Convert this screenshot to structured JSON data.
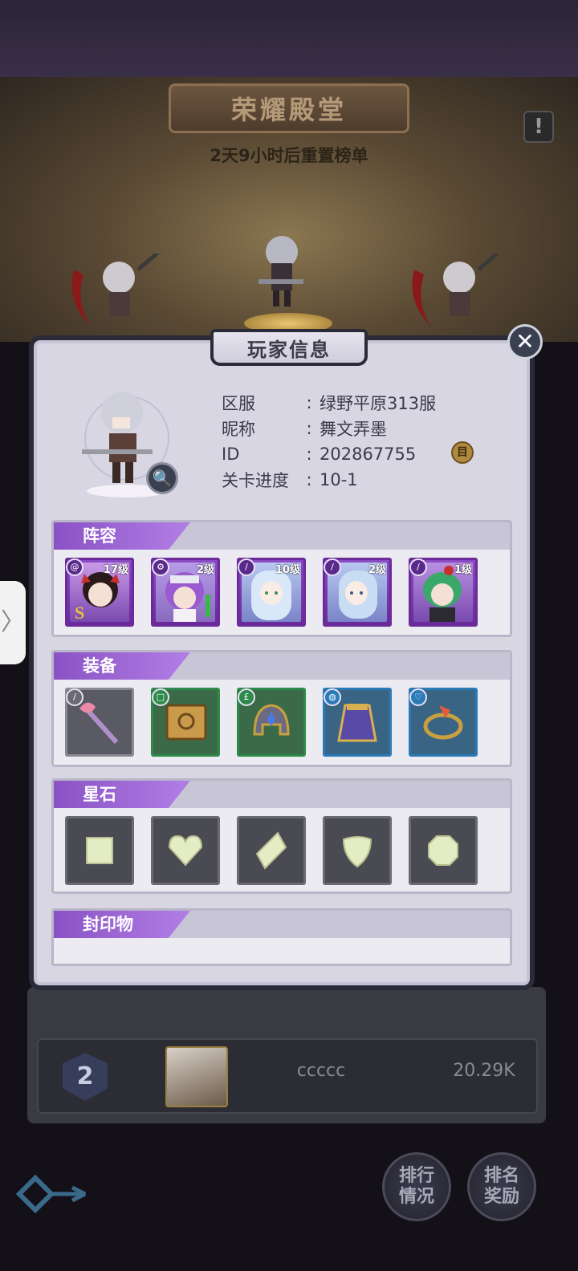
{
  "hall": {
    "title": "荣耀殿堂",
    "reset_text": "2天9小时后重置榜单",
    "alert_icon": "!"
  },
  "side_handle": {
    "icon": "〉"
  },
  "modal": {
    "title": "玩家信息",
    "close_icon": "✕",
    "magnify_icon": "🔍",
    "copy_icon": "目",
    "info": [
      {
        "label": "区服",
        "value": "绿野平原313服"
      },
      {
        "label": "昵称",
        "value": "舞文弄墨"
      },
      {
        "label": "ID",
        "value": "202867755"
      },
      {
        "label": "关卡进度",
        "value": "10-1"
      }
    ],
    "colon": ":",
    "lineup": {
      "title": "阵容",
      "heroes": [
        {
          "level": "17级",
          "icon": "swirl-icon"
        },
        {
          "level": "2级",
          "icon": "gear-icon"
        },
        {
          "level": "10级",
          "icon": "sword-icon"
        },
        {
          "level": "2级",
          "icon": "sword-icon"
        },
        {
          "level": "1级",
          "icon": "sword-icon"
        }
      ]
    },
    "equipment": {
      "title": "装备",
      "items": [
        {
          "name": "staff",
          "rarity": "grey"
        },
        {
          "name": "book",
          "rarity": "green"
        },
        {
          "name": "helmet",
          "rarity": "green"
        },
        {
          "name": "cape",
          "rarity": "blue"
        },
        {
          "name": "ring",
          "rarity": "blue"
        }
      ]
    },
    "starstones": {
      "title": "星石",
      "items": [
        "square",
        "heart",
        "diamond",
        "trillion",
        "round"
      ]
    },
    "seals": {
      "title": "封印物"
    }
  },
  "ranking": {
    "rank": "2",
    "name": "ccccc",
    "score": "20.29K"
  },
  "bottom": {
    "rank_status": "排行\n情况",
    "rank_reward": "排名\n奖励"
  },
  "colors": {
    "accent_purple": "#8a52c4",
    "panel": "#d8d6e2",
    "rarity_grey": "#8a8a94",
    "rarity_green": "#2e8a4a",
    "rarity_blue": "#2a7ab8"
  }
}
